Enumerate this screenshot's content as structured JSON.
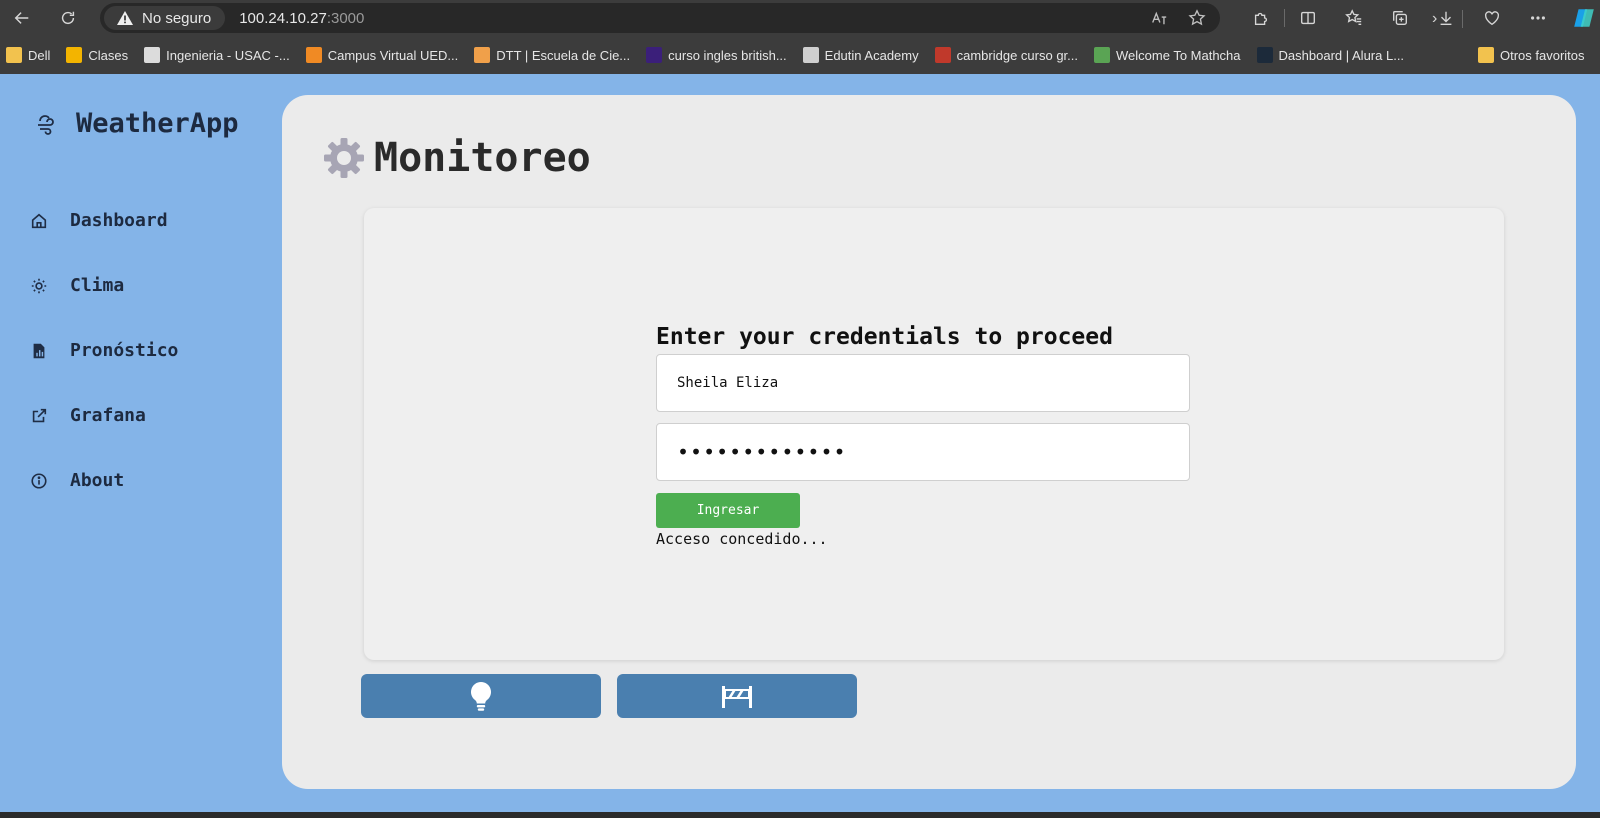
{
  "browser": {
    "security_label": "No seguro",
    "url_host": "100.24.10.27",
    "url_port": ":3000",
    "bookmarks": [
      {
        "label": "Dell",
        "icon": "folder-icon",
        "color": "#f2c24e"
      },
      {
        "label": "Clases",
        "icon": "classroom-icon",
        "color": "#f3b400"
      },
      {
        "label": "Ingenieria - USAC -...",
        "icon": "usac-icon",
        "color": "#dcdcdc"
      },
      {
        "label": "Campus Virtual UED...",
        "icon": "moodle-icon",
        "color": "#f08a24"
      },
      {
        "label": "DTT | Escuela de Cie...",
        "icon": "dtt-icon",
        "color": "#f0a04a"
      },
      {
        "label": "curso ingles british...",
        "icon": "british-council-icon",
        "color": "#3b1f7a"
      },
      {
        "label": "Edutin Academy",
        "icon": "page-icon",
        "color": "#cfcfcf"
      },
      {
        "label": "cambridge curso gr...",
        "icon": "cambridge-icon",
        "color": "#c0392b"
      },
      {
        "label": "Welcome To Mathcha",
        "icon": "mathcha-icon",
        "color": "#5aa454"
      },
      {
        "label": "Dashboard | Alura L...",
        "icon": "alura-icon",
        "color": "#1c2a3a"
      }
    ],
    "other_favorites": "Otros favoritos"
  },
  "sidebar": {
    "brand": "WeatherApp",
    "items": [
      {
        "label": "Dashboard",
        "icon": "home-icon"
      },
      {
        "label": "Clima",
        "icon": "sun-icon"
      },
      {
        "label": "Pronóstico",
        "icon": "chart-document-icon"
      },
      {
        "label": "Grafana",
        "icon": "external-link-icon"
      },
      {
        "label": "About",
        "icon": "info-icon"
      }
    ]
  },
  "main": {
    "title": "Monitoreo",
    "login": {
      "heading": "Enter your credentials to proceed",
      "username_value": "Sheila Eliza",
      "password_mask": "•••••••••••••",
      "submit_label": "Ingresar",
      "status": "Acceso concedido..."
    },
    "actions": [
      {
        "icon": "lightbulb-icon"
      },
      {
        "icon": "barrier-icon"
      }
    ]
  },
  "colors": {
    "sidebar_bg": "#84b4e8",
    "content_bg": "#ebebeb",
    "submit_green": "#4cae50",
    "action_blue": "#4a7faf"
  }
}
